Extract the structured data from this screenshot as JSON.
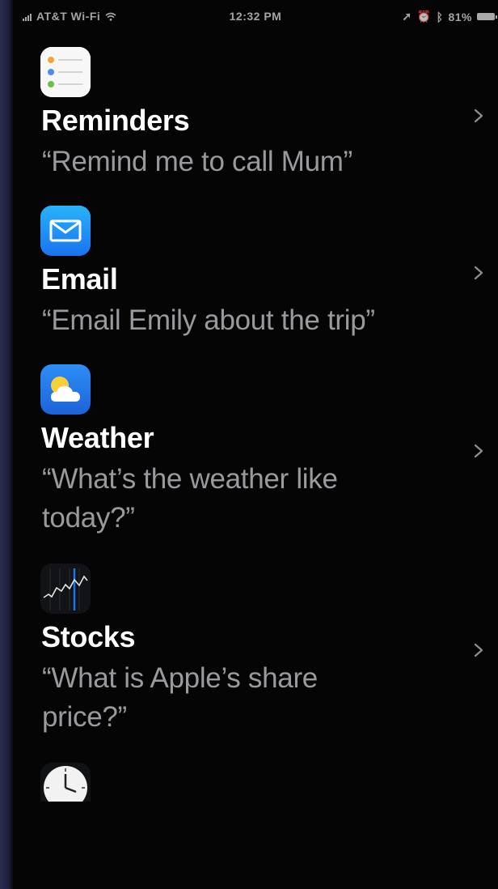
{
  "status_bar": {
    "carrier": "AT&T Wi-Fi",
    "time": "12:32 PM",
    "battery": "81%"
  },
  "items": [
    {
      "title": "Reminders",
      "example": "“Remind me to call Mum”",
      "icon": "reminders-icon"
    },
    {
      "title": "Email",
      "example": "“Email Emily about the trip”",
      "icon": "mail-icon"
    },
    {
      "title": "Weather",
      "example": "“What’s the weather like today?”",
      "icon": "weather-icon"
    },
    {
      "title": "Stocks",
      "example": "“What is Apple’s share price?”",
      "icon": "stocks-icon"
    },
    {
      "title": "",
      "example": "",
      "icon": "clock-icon"
    }
  ],
  "colors": {
    "background": "#050505",
    "title": "#ffffff",
    "example": "#9a9a9e",
    "mail_blue": "#1d8cf8",
    "weather_blue": "#2a7ff0"
  }
}
